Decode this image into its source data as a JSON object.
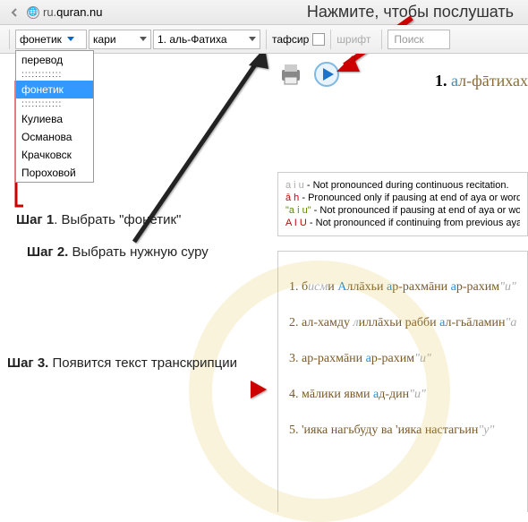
{
  "url_prefix": "ru.",
  "url_domain": "quran.nu",
  "listen_hint": "Нажмите, чтобы послушать",
  "toolbar": {
    "mode_selected": "фонетик",
    "mode_options": {
      "o1": "перевод",
      "dots1": "::::::::::::",
      "o2": "фонетик",
      "dots2": "::::::::::::",
      "o3": "Кулиева",
      "o4": "Османова",
      "o5": "Крачковск",
      "o6": "Пороховой"
    },
    "reciter": "кари",
    "surah": "1. аль-Фатиха",
    "tafsir_label": "тафсир",
    "font_label": "шрифт",
    "search_placeholder": "Поиск"
  },
  "title": {
    "num": "1.",
    "a": "а",
    "rest": "л-фāтихаx"
  },
  "legend": {
    "r1_mark": "a  i  u",
    "r1_txt": "-   Not pronounced during continuous recitation.",
    "r2_mark": "ā  h",
    "r2_txt": "-   Pronounced only if pausing at end of aya or word.",
    "r3_mark": "\"a  i  u\"",
    "r3_txt": "-   Not pronounced if pausing at end of aya or word.",
    "r4_mark": "A  I  U",
    "r4_txt": "-   Not pronounced if continuing from previous aya wit"
  },
  "verses": {
    "v1": {
      "n": "1.",
      "p1": " б",
      "p2": "исм",
      "p3": "и ",
      "b1": "А",
      "p4": "ллāхьи ",
      "b2": "а",
      "p5": "р-рахмāни ",
      "b3": "а",
      "p6": "р-рахим",
      "g": "\"и\""
    },
    "v2": {
      "n": "2.",
      "p1": " ал-хамду ",
      "i1": "л",
      "p2": "иллāхьи рабби ",
      "b1": "а",
      "p3": "л-гьāламин",
      "g": "\"а\""
    },
    "v3": {
      "n": "3.",
      "p1": " ар-рахмāни ",
      "b1": "а",
      "p2": "р-рахим",
      "g": "\"и\""
    },
    "v4": {
      "n": "4.",
      "p1": " мāлики явми ",
      "b1": "а",
      "p2": "д-дин",
      "g": "\"и\""
    },
    "v5": {
      "n": "5.",
      "p1": " 'ияка нагьбуду ва 'ияка настагьин",
      "g": "\"у\""
    }
  },
  "steps": {
    "s1a": "Шаг 1",
    "s1b": ". Выбрать \"фонетик\"",
    "s2a": "Шаг 2.",
    "s2b": " Выбрать нужную суру",
    "s3a": "Шаг 3.",
    "s3b": " Появится текст транскрипции"
  }
}
